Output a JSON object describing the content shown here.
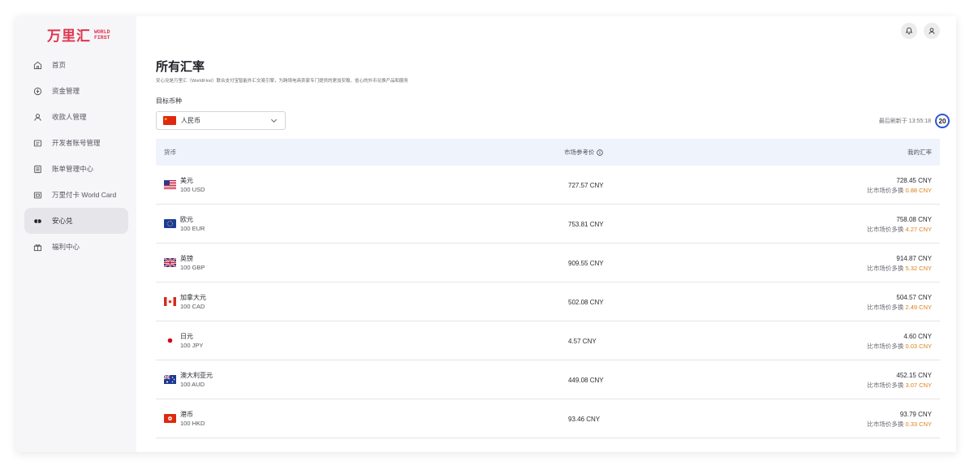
{
  "logo": {
    "cn": "万里汇",
    "en_line1": "WORLD",
    "en_line2": "FIRST"
  },
  "sidebar": {
    "items": [
      {
        "label": "首页",
        "icon": "home-icon"
      },
      {
        "label": "资金管理",
        "icon": "funds-icon"
      },
      {
        "label": "收款人管理",
        "icon": "users-icon"
      },
      {
        "label": "开发者账号管理",
        "icon": "developer-icon"
      },
      {
        "label": "账单管理中心",
        "icon": "bill-icon"
      },
      {
        "label": "万里付卡 World Card",
        "icon": "card-icon"
      },
      {
        "label": "安心兑",
        "icon": "exchange-icon"
      },
      {
        "label": "福利中心",
        "icon": "gift-icon"
      }
    ],
    "active_index": 6
  },
  "header": {
    "bell": "bell-icon",
    "user": "user-icon"
  },
  "page": {
    "title": "所有汇率",
    "subtitle": "安心兑是万里汇（WorldFirst）联合支付宝智能外汇交易引擎，为跨境电商卖家专门提供的更加安稳、省心的外币兑换产品和服务",
    "target_label": "目标币种",
    "target_currency": "人民币",
    "refresh_text": "最后刷新于 13:55:18",
    "refresh_countdown": "20"
  },
  "table": {
    "headers": {
      "currency": "货币",
      "market": "市场参考价",
      "mine": "我的汇率"
    },
    "diff_prefix": "比市场价多换",
    "rows": [
      {
        "flag": "us",
        "name": "美元",
        "amount": "100 USD",
        "market": "727.57 CNY",
        "mine": "728.45 CNY",
        "diff": "0.88 CNY"
      },
      {
        "flag": "eu",
        "name": "欧元",
        "amount": "100 EUR",
        "market": "753.81 CNY",
        "mine": "758.08 CNY",
        "diff": "4.27 CNY"
      },
      {
        "flag": "gb",
        "name": "英镑",
        "amount": "100 GBP",
        "market": "909.55 CNY",
        "mine": "914.87 CNY",
        "diff": "5.32 CNY"
      },
      {
        "flag": "ca",
        "name": "加拿大元",
        "amount": "100 CAD",
        "market": "502.08 CNY",
        "mine": "504.57 CNY",
        "diff": "2.49 CNY"
      },
      {
        "flag": "jp",
        "name": "日元",
        "amount": "100 JPY",
        "market": "4.57 CNY",
        "mine": "4.60 CNY",
        "diff": "0.03 CNY"
      },
      {
        "flag": "au",
        "name": "澳大利亚元",
        "amount": "100 AUD",
        "market": "449.08 CNY",
        "mine": "452.15 CNY",
        "diff": "3.07 CNY"
      },
      {
        "flag": "hk",
        "name": "港币",
        "amount": "100 HKD",
        "market": "93.46 CNY",
        "mine": "93.79 CNY",
        "diff": "0.33 CNY"
      }
    ]
  },
  "colors": {
    "brand": "#e0344f",
    "accent": "#2f55d4",
    "diff": "#d9801a"
  }
}
